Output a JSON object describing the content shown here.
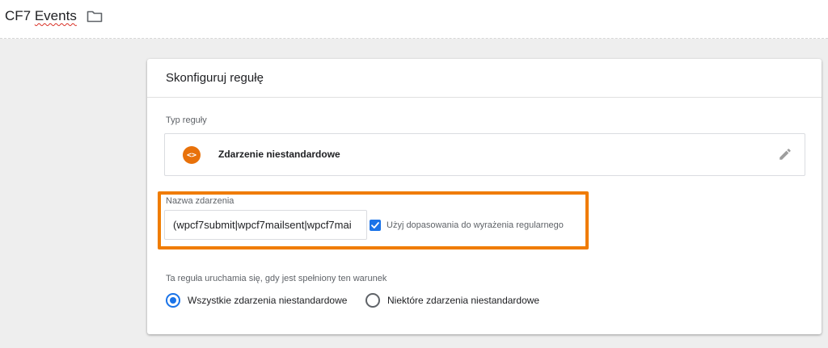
{
  "header": {
    "title_prefix": "CF7 ",
    "title_word": "Events",
    "folder_icon": "folder-icon"
  },
  "card": {
    "title": "Skonfiguruj regułę",
    "rule_type": {
      "label": "Typ reguły",
      "icon": "custom-event-icon",
      "icon_glyph": "<>",
      "name": "Zdarzenie niestandardowe",
      "edit_icon": "pencil-icon",
      "icon_color": "#e8710a"
    },
    "event_name": {
      "label": "Nazwa zdarzenia",
      "value": "(wpcf7submit|wpcf7mailsent|wpcf7mai",
      "highlight_color": "#f07c00"
    },
    "regex": {
      "checked": true,
      "label": "Użyj dopasowania do wyrażenia regularnego",
      "color": "#1a73e8"
    },
    "condition": {
      "label": "Ta reguła uruchamia się, gdy jest spełniony ten warunek",
      "options": [
        {
          "label": "Wszystkie zdarzenia niestandardowe",
          "selected": true
        },
        {
          "label": "Niektóre zdarzenia niestandardowe",
          "selected": false
        }
      ]
    }
  }
}
